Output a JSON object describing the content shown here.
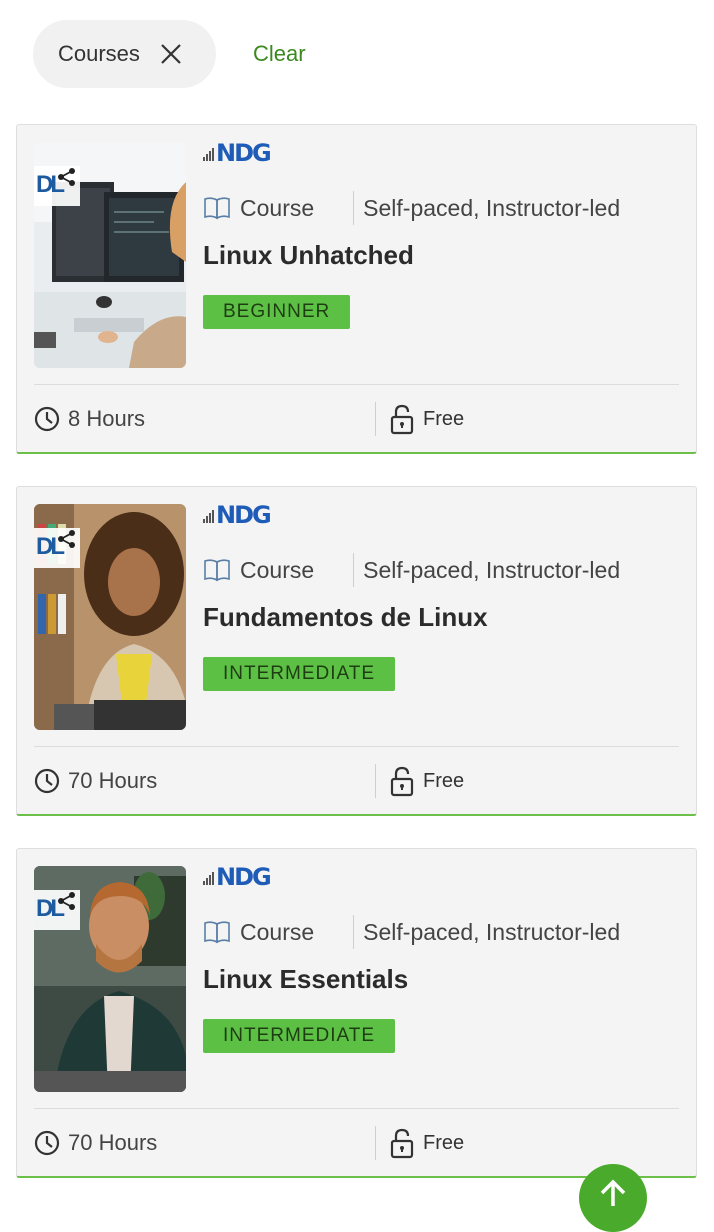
{
  "filters": {
    "chip_label": "Courses",
    "clear_label": "Clear"
  },
  "colors": {
    "accent_green": "#3b8a20",
    "badge_green": "#5cc045",
    "provider_blue": "#1f5cb8",
    "card_bg": "#f4f4f4"
  },
  "courses": [
    {
      "provider": "NDG",
      "type": "Course",
      "pace": "Self-paced, Instructor-led",
      "title": "Linux Unhatched",
      "level": "BEGINNER",
      "duration": "8 Hours",
      "price": "Free",
      "thumb_label": "DL",
      "thumb_scene": "person-at-monitors"
    },
    {
      "provider": "NDG",
      "type": "Course",
      "pace": "Self-paced, Instructor-led",
      "title": "Fundamentos de Linux",
      "level": "INTERMEDIATE",
      "duration": "70 Hours",
      "price": "Free",
      "thumb_label": "DL",
      "thumb_scene": "woman-with-laptop"
    },
    {
      "provider": "NDG",
      "type": "Course",
      "pace": "Self-paced, Instructor-led",
      "title": "Linux Essentials",
      "level": "INTERMEDIATE",
      "duration": "70 Hours",
      "price": "Free",
      "thumb_label": "DL",
      "thumb_scene": "smiling-man"
    }
  ],
  "icons": {
    "chip_close": "close-icon",
    "share": "share-icon",
    "book": "book-icon",
    "clock": "clock-icon",
    "lock": "unlock-icon",
    "scroll_top": "arrow-up-icon"
  }
}
